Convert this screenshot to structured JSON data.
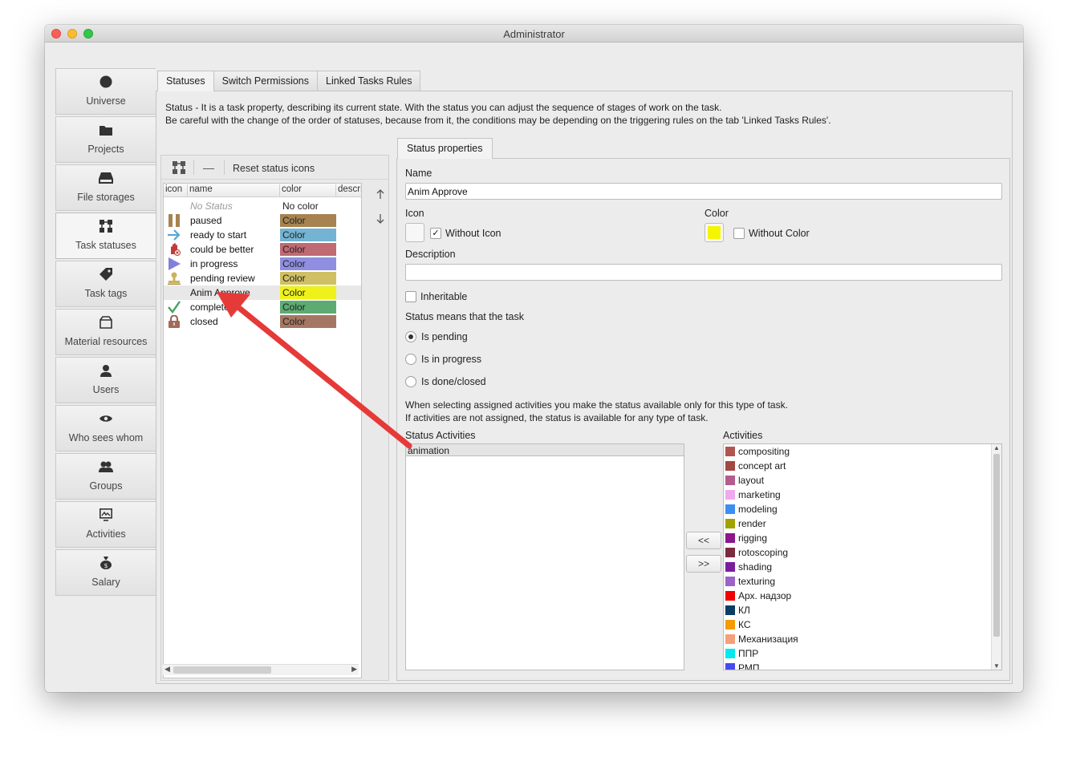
{
  "window": {
    "title": "Administrator"
  },
  "sidebar": {
    "items": [
      {
        "label": "Universe",
        "icon": "circle-icon"
      },
      {
        "label": "Projects",
        "icon": "folder-icon"
      },
      {
        "label": "File storages",
        "icon": "storage-icon"
      },
      {
        "label": "Task statuses",
        "icon": "statuses-icon",
        "active": true
      },
      {
        "label": "Task tags",
        "icon": "tag-icon"
      },
      {
        "label": "Material resources",
        "icon": "box-icon"
      },
      {
        "label": "Users",
        "icon": "user-icon"
      },
      {
        "label": "Who sees whom",
        "icon": "eye-icon"
      },
      {
        "label": "Groups",
        "icon": "group-icon"
      },
      {
        "label": "Activities",
        "icon": "activities-icon"
      },
      {
        "label": "Salary",
        "icon": "money-bag-icon"
      }
    ]
  },
  "tabs": [
    "Statuses",
    "Switch Permissions",
    "Linked Tasks Rules"
  ],
  "info": {
    "line1": "Status - It is a task property, describing its current state. With the status you can adjust the sequence of stages of work on the task.",
    "line2": "Be careful with the change of the order of statuses, because from it, the conditions may be depending on the triggering rules on the tab 'Linked Tasks Rules'."
  },
  "toolbar": {
    "reset_label": "Reset status icons",
    "remove_label": "—"
  },
  "table": {
    "headers": [
      "icon",
      "name",
      "color",
      "descri"
    ],
    "rows": [
      {
        "name": "No Status",
        "color_label": "No color",
        "color": null,
        "icon": ""
      },
      {
        "name": "paused",
        "color_label": "Color",
        "color": "#a68350",
        "icon": "pause-icon"
      },
      {
        "name": "ready to start",
        "color_label": "Color",
        "color": "#74b3d3",
        "icon": "arrow-right-icon"
      },
      {
        "name": "could be better",
        "color_label": "Color",
        "color": "#c06a73",
        "icon": "hand-x-icon"
      },
      {
        "name": "in progress",
        "color_label": "Color",
        "color": "#8f8ee1",
        "icon": "play-icon"
      },
      {
        "name": "pending review",
        "color_label": "Color",
        "color": "#d0c064",
        "icon": "stamp-icon"
      },
      {
        "name": "Anim Approve",
        "color_label": "Color",
        "color": "#eef21a",
        "icon": "",
        "selected": true
      },
      {
        "name": "complete",
        "color_label": "Color",
        "color": "#5eab72",
        "icon": "check-icon"
      },
      {
        "name": "closed",
        "color_label": "Color",
        "color": "#a57762",
        "icon": "lock-icon"
      }
    ]
  },
  "props": {
    "tab": "Status properties",
    "name_label": "Name",
    "name_value": "Anim Approve",
    "icon_label": "Icon",
    "without_icon": "Without Icon",
    "without_icon_checked": "✓",
    "color_label": "Color",
    "color_value": "#f5f500",
    "without_color": "Without Color",
    "description_label": "Description",
    "description_value": "",
    "inheritable": "Inheritable",
    "status_means": "Status means that the task",
    "radios": [
      "Is pending",
      "Is in progress",
      "Is done/closed"
    ],
    "note1": "When selecting assigned activities you make the status available only for this type of task.",
    "note2": "If activities are not assigned, the status is available for any type of task.",
    "status_activities_label": "Status Activities",
    "status_activities": [
      "animation"
    ],
    "activities_label": "Activities",
    "btn_left": "<<",
    "btn_right": ">>",
    "activities": [
      {
        "name": "compositing",
        "color": "#b25550"
      },
      {
        "name": "concept art",
        "color": "#a04a42"
      },
      {
        "name": "layout",
        "color": "#b45c8c"
      },
      {
        "name": "marketing",
        "color": "#f2a8ef"
      },
      {
        "name": "modeling",
        "color": "#3c8ef2"
      },
      {
        "name": "render",
        "color": "#a1a100"
      },
      {
        "name": "rigging",
        "color": "#8c168c"
      },
      {
        "name": "rotoscoping",
        "color": "#7b2b3e"
      },
      {
        "name": "shading",
        "color": "#7b1e9e"
      },
      {
        "name": "texturing",
        "color": "#9b63c7"
      },
      {
        "name": "Арх. надзор",
        "color": "#f20000"
      },
      {
        "name": "КЛ",
        "color": "#0a3c64"
      },
      {
        "name": "КС",
        "color": "#f59b00"
      },
      {
        "name": "Механизация",
        "color": "#f5a07a"
      },
      {
        "name": "ППР",
        "color": "#00e8f0"
      },
      {
        "name": "РМП",
        "color": "#4a4af0"
      }
    ]
  }
}
